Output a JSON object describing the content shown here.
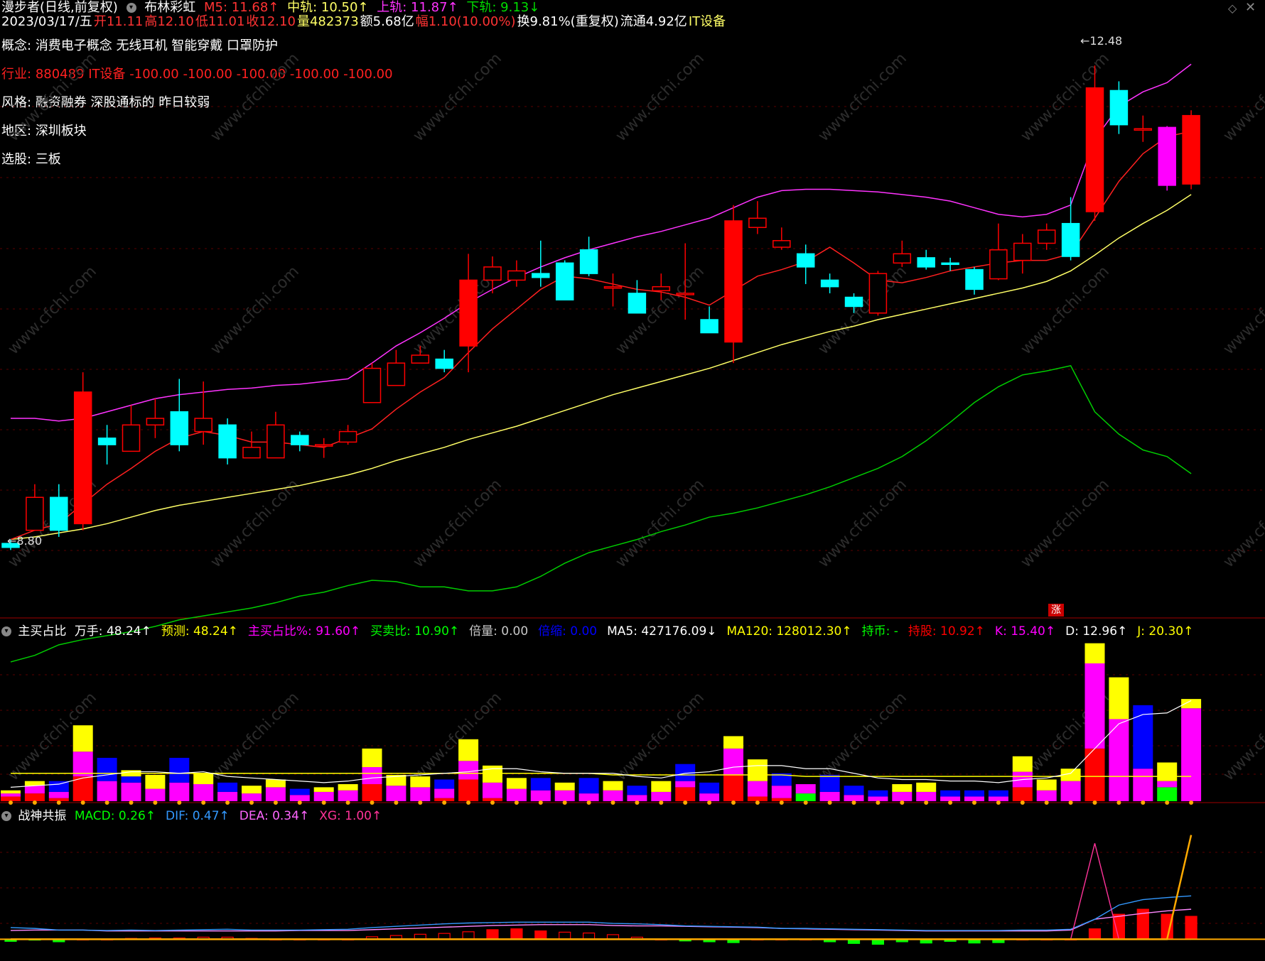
{
  "header": {
    "stock": "漫步者(日线,前复权)",
    "indicator": "布林彩虹",
    "date": "2023/03/17/五",
    "open_label": "开",
    "open": "11.11",
    "high_label": "高",
    "high": "12.10",
    "low_label": "低",
    "low": "11.01",
    "close_label": "收",
    "close": "12.10",
    "vol_label": "量",
    "vol": "482373",
    "amount": "额5.68亿",
    "change": "幅1.10(10.00%)",
    "turnover": "换9.81%(重复权)",
    "float": "流通4.92亿",
    "sector": "IT设备",
    "m5": "M5: 11.68↑",
    "mid": "中轨: 10.50↑",
    "upper": "上轨: 11.87↑",
    "lower": "下轨: 9.13↓"
  },
  "info": {
    "concept_key": "概念:",
    "concept_val": "消费电子概念 无线耳机 智能穿戴 口罩防护",
    "industry_key": "行业:",
    "industry_val": "880489 IT设备 -100.00 -100.00 -100.00 -100.00 -100.00",
    "style_key": "风格:",
    "style_val": "融资融券 深股通标的 昨日较弱",
    "region_key": "地区:",
    "region_val": "深圳板块",
    "pick_key": "选股:",
    "pick_val": "三板"
  },
  "annotations": {
    "high_mark": "12.48",
    "low_mark": "8.80",
    "zhang": "涨",
    "watermark": "www.cfchi.com"
  },
  "pane2": {
    "name": "主买占比",
    "items": [
      {
        "text": "万手: 48.24↑",
        "color": "#ffffff"
      },
      {
        "text": "预测: 48.24↑",
        "color": "#ffff00"
      },
      {
        "text": "主买占比%: 91.60↑",
        "color": "#ff00ff"
      },
      {
        "text": "买卖比: 10.90↑",
        "color": "#00ff00"
      },
      {
        "text": "倍量: 0.00",
        "color": "#c8c8c8"
      },
      {
        "text": "倍缩: 0.00",
        "color": "#0000ff"
      },
      {
        "text": "MA5: 427176.09↓",
        "color": "#ffffff"
      },
      {
        "text": "MA120: 128012.30↑",
        "color": "#ffff00"
      },
      {
        "text": "持币: -",
        "color": "#00ff00"
      },
      {
        "text": "持股: 10.92↑",
        "color": "#ff0000"
      },
      {
        "text": "K: 15.40↑",
        "color": "#ff00ff"
      },
      {
        "text": "D: 12.96↑",
        "color": "#ffffff"
      },
      {
        "text": "J: 20.30↑",
        "color": "#ffff00"
      }
    ]
  },
  "pane3": {
    "name": "战神共振",
    "items": [
      {
        "text": "MACD: 0.26↑",
        "color": "#00ff00"
      },
      {
        "text": "DIF: 0.47↑",
        "color": "#3399ff"
      },
      {
        "text": "DEA: 0.34↑",
        "color": "#ff66ff"
      },
      {
        "text": "XG: 1.00↑",
        "color": "#ff3399"
      }
    ]
  },
  "chart_data": {
    "type": "candlestick",
    "ylim": [
      8.5,
      12.6
    ],
    "candles": [
      [
        8.85,
        8.82,
        8.88,
        8.8
      ],
      [
        8.95,
        9.2,
        9.3,
        8.95
      ],
      [
        9.2,
        8.95,
        9.3,
        8.9
      ],
      [
        9.0,
        10.0,
        10.15,
        8.95
      ],
      [
        9.65,
        9.6,
        9.75,
        9.45
      ],
      [
        9.55,
        9.75,
        9.9,
        9.55
      ],
      [
        9.75,
        9.8,
        9.95,
        9.65
      ],
      [
        9.85,
        9.6,
        10.1,
        9.55
      ],
      [
        9.7,
        9.8,
        10.08,
        9.6
      ],
      [
        9.75,
        9.5,
        9.8,
        9.45
      ],
      [
        9.5,
        9.58,
        9.7,
        9.5
      ],
      [
        9.5,
        9.75,
        9.85,
        9.5
      ],
      [
        9.67,
        9.6,
        9.7,
        9.55
      ],
      [
        9.6,
        9.6,
        9.65,
        9.5
      ],
      [
        9.62,
        9.7,
        9.75,
        9.6
      ],
      [
        9.92,
        10.18,
        10.22,
        9.95
      ],
      [
        10.05,
        10.22,
        10.32,
        10.15
      ],
      [
        10.22,
        10.28,
        10.35,
        10.25
      ],
      [
        10.25,
        10.18,
        10.32,
        10.15
      ],
      [
        10.35,
        10.85,
        11.05,
        10.15
      ],
      [
        10.85,
        10.95,
        11.03,
        10.75
      ],
      [
        10.85,
        10.92,
        11.0,
        10.8
      ],
      [
        10.9,
        10.87,
        11.15,
        10.8
      ],
      [
        10.98,
        10.7,
        11.0,
        10.7
      ],
      [
        11.08,
        10.9,
        11.18,
        10.88
      ],
      [
        10.8,
        10.8,
        10.9,
        10.65
      ],
      [
        10.75,
        10.6,
        10.85,
        10.62
      ],
      [
        10.77,
        10.8,
        10.9,
        10.7
      ],
      [
        10.75,
        10.75,
        11.13,
        10.55
      ],
      [
        10.55,
        10.45,
        10.65,
        10.55
      ],
      [
        10.38,
        11.3,
        11.42,
        10.22
      ],
      [
        11.25,
        11.32,
        11.45,
        11.2
      ],
      [
        11.1,
        11.15,
        11.25,
        11.08
      ],
      [
        11.05,
        10.95,
        11.12,
        10.82
      ],
      [
        10.85,
        10.8,
        10.9,
        10.75
      ],
      [
        10.72,
        10.65,
        10.75,
        10.6
      ],
      [
        10.6,
        10.9,
        10.92,
        10.58
      ],
      [
        10.98,
        11.05,
        11.15,
        10.95
      ],
      [
        11.02,
        10.95,
        11.08,
        10.93
      ],
      [
        10.98,
        10.97,
        11.02,
        10.92
      ],
      [
        10.93,
        10.78,
        10.95,
        10.74
      ],
      [
        10.86,
        11.08,
        11.28,
        10.85
      ],
      [
        11.0,
        11.13,
        11.2,
        10.9
      ],
      [
        11.13,
        11.23,
        11.28,
        11.08
      ],
      [
        11.28,
        11.03,
        11.48,
        11.0
      ],
      [
        11.37,
        12.31,
        12.48,
        11.3
      ],
      [
        12.29,
        12.03,
        12.36,
        11.96
      ],
      [
        12.0,
        12.0,
        12.1,
        11.9
      ],
      [
        12.01,
        11.57,
        12.02,
        11.53
      ],
      [
        11.58,
        12.1,
        12.14,
        11.54
      ]
    ],
    "ma5": [
      8.88,
      8.95,
      9.0,
      9.15,
      9.3,
      9.42,
      9.55,
      9.65,
      9.7,
      9.67,
      9.62,
      9.62,
      9.6,
      9.58,
      9.65,
      9.72,
      9.87,
      10.0,
      10.11,
      10.3,
      10.48,
      10.63,
      10.78,
      10.88,
      10.86,
      10.82,
      10.78,
      10.76,
      10.72,
      10.66,
      10.77,
      10.88,
      10.93,
      10.99,
      11.1,
      10.98,
      10.85,
      10.83,
      10.87,
      10.92,
      10.95,
      10.98,
      11.0,
      11.0,
      11.05,
      11.32,
      11.6,
      11.81,
      11.94,
      11.98
    ],
    "mid": [
      8.88,
      8.9,
      8.93,
      8.96,
      9.0,
      9.05,
      9.1,
      9.14,
      9.17,
      9.2,
      9.23,
      9.26,
      9.29,
      9.33,
      9.37,
      9.42,
      9.48,
      9.53,
      9.58,
      9.64,
      9.69,
      9.74,
      9.8,
      9.86,
      9.92,
      9.98,
      10.03,
      10.08,
      10.13,
      10.18,
      10.24,
      10.3,
      10.36,
      10.41,
      10.46,
      10.5,
      10.55,
      10.59,
      10.63,
      10.67,
      10.71,
      10.75,
      10.79,
      10.84,
      10.92,
      11.04,
      11.17,
      11.28,
      11.38,
      11.5
    ],
    "upper": [
      9.8,
      9.8,
      9.78,
      9.8,
      9.85,
      9.9,
      9.95,
      9.98,
      10.0,
      10.02,
      10.03,
      10.05,
      10.06,
      10.08,
      10.1,
      10.22,
      10.35,
      10.45,
      10.56,
      10.68,
      10.78,
      10.87,
      10.95,
      11.02,
      11.08,
      11.13,
      11.18,
      11.22,
      11.27,
      11.32,
      11.4,
      11.48,
      11.53,
      11.54,
      11.54,
      11.53,
      11.52,
      11.5,
      11.48,
      11.45,
      11.4,
      11.35,
      11.33,
      11.35,
      11.42,
      11.92,
      12.17,
      12.28,
      12.35,
      12.49
    ],
    "lower": [
      7.95,
      8.0,
      8.08,
      8.12,
      8.15,
      8.18,
      8.22,
      8.27,
      8.3,
      8.33,
      8.36,
      8.4,
      8.45,
      8.48,
      8.53,
      8.57,
      8.56,
      8.52,
      8.52,
      8.49,
      8.49,
      8.52,
      8.6,
      8.7,
      8.78,
      8.83,
      8.88,
      8.94,
      8.99,
      9.05,
      9.08,
      9.12,
      9.17,
      9.22,
      9.28,
      9.35,
      9.42,
      9.51,
      9.63,
      9.77,
      9.92,
      10.04,
      10.13,
      10.16,
      10.2,
      9.85,
      9.68,
      9.56,
      9.51,
      9.38
    ]
  },
  "volume_data": {
    "ymax": 10,
    "bars": [
      [
        0.3,
        0.2,
        0,
        0.2,
        0
      ],
      [
        0.5,
        0.5,
        0,
        0.3,
        0
      ],
      [
        0.2,
        0.4,
        0.7,
        0,
        0
      ],
      [
        1.6,
        1.6,
        0,
        1.7,
        0
      ],
      [
        0,
        1.3,
        1.5,
        0,
        0
      ],
      [
        0,
        1.2,
        0.4,
        0.4,
        0
      ],
      [
        0,
        0.8,
        0,
        0.9,
        0
      ],
      [
        0,
        1.2,
        1.6,
        0,
        0
      ],
      [
        0,
        1.1,
        0,
        0.7,
        0
      ],
      [
        0,
        0.6,
        0.6,
        0,
        0
      ],
      [
        0,
        0.5,
        0,
        0.5,
        0
      ],
      [
        0,
        0.9,
        0,
        0.5,
        0
      ],
      [
        0,
        0.4,
        0.4,
        0,
        0
      ],
      [
        0,
        0.6,
        0,
        0.3,
        0
      ],
      [
        0,
        0.7,
        0,
        0.4,
        0
      ],
      [
        1.1,
        1.1,
        0,
        1.2,
        0
      ],
      [
        0,
        1.0,
        0,
        0.7,
        0
      ],
      [
        0,
        0.9,
        0,
        0.7,
        0
      ],
      [
        0.2,
        0.6,
        0.6,
        0,
        0
      ],
      [
        1.4,
        1.2,
        0,
        1.4,
        0
      ],
      [
        0.2,
        1.0,
        0,
        1.1,
        0
      ],
      [
        0,
        0.8,
        0,
        0.7,
        0
      ],
      [
        0,
        0.7,
        0.8,
        0,
        0
      ],
      [
        0,
        0.7,
        0,
        0.5,
        0
      ],
      [
        0,
        0.5,
        1.0,
        0,
        0
      ],
      [
        0,
        0.7,
        0,
        0.6,
        0
      ],
      [
        0,
        0.4,
        0.6,
        0,
        0
      ],
      [
        0,
        0.6,
        0,
        0.7,
        0
      ],
      [
        0.9,
        0.4,
        1.1,
        0,
        0
      ],
      [
        0,
        0.5,
        0.7,
        0,
        0
      ],
      [
        1.7,
        1.7,
        0,
        0.8,
        0
      ],
      [
        0.3,
        1.0,
        0,
        1.4,
        0
      ],
      [
        0.2,
        0.8,
        0.8,
        0,
        0
      ],
      [
        0,
        0.6,
        0,
        0,
        0.5
      ],
      [
        0,
        0.6,
        1.1,
        0,
        0
      ],
      [
        0,
        0.4,
        0.6,
        0,
        0
      ],
      [
        0,
        0.3,
        0.4,
        0,
        0
      ],
      [
        0,
        0.6,
        0,
        0.5,
        0
      ],
      [
        0,
        0.6,
        0,
        0.6,
        0
      ],
      [
        0,
        0.3,
        0.4,
        0,
        0
      ],
      [
        0,
        0.3,
        0.4,
        0,
        0
      ],
      [
        0,
        0.3,
        0.4,
        0,
        0
      ],
      [
        0.9,
        1.0,
        0,
        1.0,
        0
      ],
      [
        0,
        0.7,
        0,
        0.7,
        0
      ],
      [
        0,
        1.3,
        0,
        0.8,
        0
      ],
      [
        3.4,
        5.5,
        0,
        1.3,
        0
      ],
      [
        0,
        5.3,
        0,
        2.7,
        0
      ],
      [
        0,
        2.1,
        4.1,
        0,
        0
      ],
      [
        0,
        0.4,
        0,
        1.2,
        0.9
      ],
      [
        0,
        6.0,
        0,
        0.6,
        0
      ]
    ],
    "ma": [
      0.9,
      1.0,
      1.1,
      1.5,
      1.7,
      1.9,
      1.9,
      1.8,
      1.9,
      1.6,
      1.5,
      1.4,
      1.3,
      1.2,
      1.3,
      1.5,
      1.6,
      1.7,
      1.8,
      1.9,
      2.1,
      2.1,
      1.9,
      1.8,
      1.8,
      1.8,
      1.6,
      1.5,
      1.8,
      1.9,
      2.2,
      2.3,
      2.3,
      2.1,
      2.1,
      1.8,
      1.5,
      1.4,
      1.4,
      1.3,
      1.3,
      1.2,
      1.4,
      1.5,
      1.8,
      3.4,
      5.0,
      5.6,
      5.7,
      6.5
    ],
    "ma2": [
      1.8,
      1.8,
      1.8,
      1.8,
      1.8,
      1.8,
      1.8,
      1.8,
      1.8,
      1.8,
      1.8,
      1.8,
      1.8,
      1.8,
      1.8,
      1.8,
      1.8,
      1.8,
      1.8,
      1.8,
      1.8,
      1.8,
      1.8,
      1.8,
      1.8,
      1.7,
      1.7,
      1.7,
      1.7,
      1.7,
      1.7,
      1.7,
      1.7,
      1.6,
      1.6,
      1.6,
      1.6,
      1.6,
      1.6,
      1.6,
      1.6,
      1.6,
      1.6,
      1.6,
      1.6,
      1.6,
      1.6,
      1.6,
      1.6,
      1.6
    ]
  },
  "macd_data": {
    "ymin": -0.3,
    "ymax": 2.8,
    "hist": [
      -0.05,
      -0.02,
      -0.06,
      0.0,
      0.0,
      0.02,
      0.03,
      0.03,
      0.05,
      0.05,
      0.02,
      0.0,
      0.0,
      0.0,
      0.0,
      0.06,
      0.09,
      0.12,
      0.14,
      0.18,
      0.23,
      0.25,
      0.2,
      0.17,
      0.15,
      0.11,
      0.05,
      0.0,
      -0.04,
      -0.06,
      -0.08,
      0.0,
      0.0,
      0.0,
      -0.06,
      -0.1,
      -0.12,
      -0.06,
      -0.09,
      -0.05,
      -0.09,
      -0.08,
      0.0,
      0.0,
      0.0,
      0.25,
      0.6,
      0.72,
      0.6,
      0.55
    ],
    "dif": [
      0.28,
      0.26,
      0.22,
      0.22,
      0.21,
      0.22,
      0.21,
      0.22,
      0.23,
      0.24,
      0.22,
      0.22,
      0.22,
      0.23,
      0.24,
      0.28,
      0.31,
      0.34,
      0.37,
      0.39,
      0.4,
      0.41,
      0.41,
      0.41,
      0.41,
      0.38,
      0.37,
      0.35,
      0.32,
      0.31,
      0.3,
      0.29,
      0.26,
      0.26,
      0.25,
      0.24,
      0.23,
      0.22,
      0.21,
      0.21,
      0.21,
      0.21,
      0.22,
      0.22,
      0.24,
      0.48,
      0.82,
      0.95,
      1.0,
      1.04
    ],
    "dea": [
      0.21,
      0.22,
      0.22,
      0.22,
      0.2,
      0.2,
      0.2,
      0.2,
      0.2,
      0.2,
      0.2,
      0.2,
      0.21,
      0.21,
      0.21,
      0.23,
      0.25,
      0.27,
      0.29,
      0.31,
      0.33,
      0.34,
      0.35,
      0.35,
      0.35,
      0.33,
      0.32,
      0.32,
      0.31,
      0.3,
      0.29,
      0.28,
      0.26,
      0.25,
      0.24,
      0.23,
      0.22,
      0.21,
      0.2,
      0.2,
      0.2,
      0.2,
      0.2,
      0.2,
      0.22,
      0.48,
      0.55,
      0.62,
      0.68,
      0.72
    ],
    "xg": [
      0,
      0,
      0,
      0,
      0,
      0,
      0,
      0,
      0,
      0,
      0,
      0,
      0,
      0,
      0,
      0,
      0,
      0,
      0,
      0,
      0,
      0,
      0,
      0,
      0,
      0,
      0,
      0,
      0,
      0,
      0,
      0,
      0,
      0,
      0,
      0,
      0,
      0,
      0,
      0,
      0,
      0,
      0,
      0,
      0,
      2.3,
      0,
      0,
      0,
      0
    ],
    "orange": [
      0,
      0,
      0,
      0,
      0,
      0,
      0,
      0,
      0,
      0,
      0,
      0,
      0,
      0,
      0,
      0,
      0,
      0,
      0,
      0,
      0,
      0,
      0,
      0,
      0,
      0,
      0,
      0,
      0,
      0,
      0,
      0,
      0,
      0,
      0,
      0,
      0,
      0,
      0,
      0,
      0,
      0,
      0,
      0,
      0,
      0,
      0,
      0,
      0,
      2.5
    ]
  },
  "colors": {
    "up": "#ff0000",
    "down": "#00ffff",
    "bigdown": "#ff00ff",
    "mid": "#ffff66",
    "upper": "#ff33ff",
    "lower": "#00cc00",
    "ma5": "#ff2020"
  }
}
